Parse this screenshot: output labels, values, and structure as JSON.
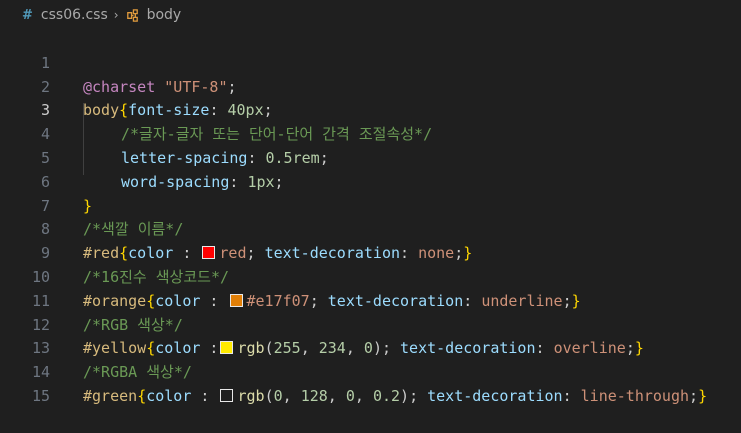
{
  "breadcrumb": {
    "file_icon": "#",
    "file_name": "css06.css",
    "separator": "›",
    "symbol_name": "body"
  },
  "colors": {
    "red": "#ff0000",
    "orange": "#e17f07",
    "yellow": "rgb(255, 234, 0)",
    "green": "rgba(0, 128, 0, 0.2)"
  },
  "lines": {
    "n1": "1",
    "n2": "2",
    "n3": "3",
    "n4": "4",
    "n5": "5",
    "n6": "6",
    "n7": "7",
    "n8": "8",
    "n9": "9",
    "n10": "10",
    "n11": "11",
    "n12": "12",
    "n13": "13",
    "n14": "14",
    "n15": "15"
  },
  "code": {
    "l1": {
      "at": "@charset",
      "str": "\"UTF-8\"",
      "end": ";"
    },
    "l2": {
      "sel": "body",
      "brace": "{",
      "prop": "font-size",
      "colon": ": ",
      "num": "40px",
      "end": ";"
    },
    "l3": {
      "comment": "/*글자-글자 또는 단어-단어 간격 조절속성*/"
    },
    "l4": {
      "prop": "letter-spacing",
      "colon": ": ",
      "num": "0.5rem",
      "end": ";"
    },
    "l5": {
      "prop": "word-spacing",
      "colon": ": ",
      "num": "1px",
      "end": ";"
    },
    "l6": {
      "brace": "}"
    },
    "l7": {
      "comment": "/*색깔 이름*/"
    },
    "l8": {
      "sel": "#red",
      "brace": "{",
      "prop": "color",
      "colon": " : ",
      "val": "red",
      "semi": "; ",
      "prop2": "text-decoration",
      "colon2": ": ",
      "val2": "none",
      "end": ";",
      "brace2": "}"
    },
    "l9": {
      "comment": "/*16진수 색상코드*/"
    },
    "l10": {
      "sel": "#orange",
      "brace": "{",
      "prop": "color",
      "colon": " : ",
      "val": "#e17f07",
      "semi": "; ",
      "prop2": "text-decoration",
      "colon2": ": ",
      "val2": "underline",
      "end": ";",
      "brace2": "}"
    },
    "l11": {
      "comment": "/*RGB 색상*/"
    },
    "l12": {
      "sel": "#yellow",
      "brace": "{",
      "prop": "color",
      "colon": " :",
      "fn": "rgb",
      "open": "(",
      "a": "255",
      "c1": ", ",
      "b": "234",
      "c2": ", ",
      "c": "0",
      "close": ")",
      "semi": "; ",
      "prop2": "text-decoration",
      "colon2": ": ",
      "val2": "overline",
      "end": ";",
      "brace2": "}"
    },
    "l13": {
      "comment": "/*RGBA 색상*/"
    },
    "l14": {
      "sel": "#green",
      "brace": "{",
      "prop": "color",
      "colon": " : ",
      "fn": "rgb",
      "open": "(",
      "a": "0",
      "c1": ", ",
      "b": "128",
      "c2": ", ",
      "c": "0",
      "c3": ", ",
      "d": "0.2",
      "close": ")",
      "semi": "; ",
      "prop2": "text-decoration",
      "colon2": ": ",
      "val2": "line-through",
      "end": ";",
      "brace2": "}"
    }
  }
}
